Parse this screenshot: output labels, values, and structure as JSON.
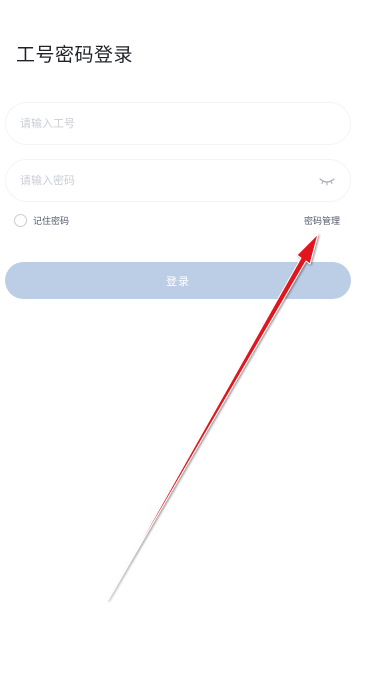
{
  "page": {
    "title": "工号密码登录"
  },
  "form": {
    "username_placeholder": "请输入工号",
    "username_value": "",
    "password_placeholder": "请输入密码",
    "password_value": "",
    "password_toggle_icon": "eye-closed-icon",
    "remember_label": "记住密码",
    "remember_checked": false,
    "manage_link": "密码管理",
    "submit_label": "登录"
  },
  "colors": {
    "button_bg": "#bccde6",
    "button_text": "#ffffff",
    "placeholder": "#c9cdd4",
    "title": "#1f2329",
    "annotation_arrow": "#e0141e"
  },
  "annotation": {
    "type": "arrow",
    "points_to": "password-manage-link"
  }
}
